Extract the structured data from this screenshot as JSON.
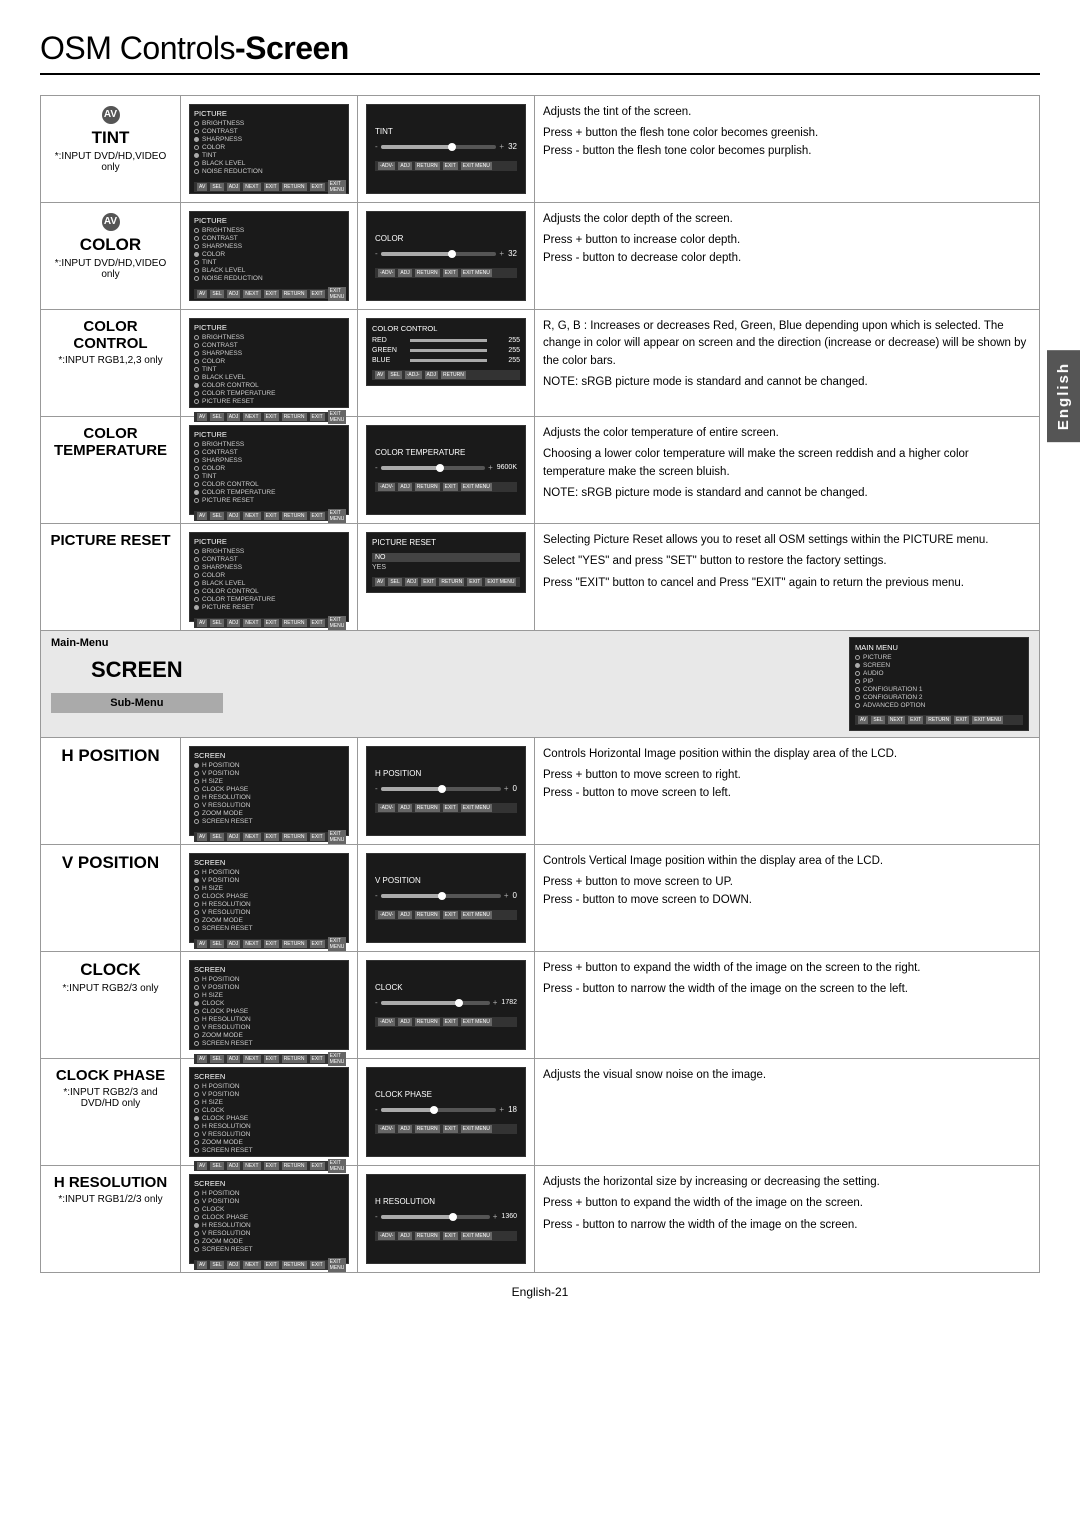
{
  "title": {
    "prefix": "OSM Controls",
    "suffix": "-Screen"
  },
  "english_tab": "English",
  "sections": {
    "tint": {
      "label": "TINT",
      "av_badge": "AV",
      "sub_label": "*:INPUT DVD/HD,VIDEO only",
      "slider_label": "TINT",
      "slider_value": "+ 32",
      "description": [
        "Adjusts the tint of the screen.",
        "Press + button the flesh tone color becomes greenish.",
        "Press - button the flesh tone color becomes purplish."
      ]
    },
    "color": {
      "label": "COLOR",
      "av_badge": "AV",
      "sub_label": "*:INPUT DVD/HD,VIDEO only",
      "slider_label": "COLOR",
      "slider_value": "+ 32",
      "description": [
        "Adjusts the color depth of the screen.",
        "Press + button to increase color depth.",
        "Press - button to decrease color depth."
      ]
    },
    "color_control": {
      "label": "COLOR CONTROL",
      "sub_label": "*:INPUT RGB1,2,3 only",
      "slider_label": "COLOR CONTROL",
      "rgb": {
        "red": {
          "label": "RED",
          "value": "255",
          "fill": 100
        },
        "green": {
          "label": "GREEN",
          "value": "255",
          "fill": 100
        },
        "blue": {
          "label": "BLUE",
          "value": "255",
          "fill": 100
        }
      },
      "description": [
        "R, G, B : Increases or decreases Red, Green, Blue depending upon which is selected. The change in color will appear on screen and the direction (increase or decrease) will be shown by the color bars.",
        "NOTE: sRGB picture mode is standard and cannot be changed."
      ]
    },
    "color_temperature": {
      "label": "COLOR TEMPERATURE",
      "slider_label": "COLOR TEMPERATURE",
      "slider_value": "9600K",
      "description": [
        "Adjusts the color temperature of entire screen.",
        "Choosing a lower color temperature will make the screen reddish and a higher color temperature make the screen bluish.",
        "NOTE: sRGB picture mode is standard and cannot be changed."
      ]
    },
    "picture_reset": {
      "label": "PICTURE RESET",
      "description": [
        "Selecting Picture Reset allows you to reset all OSM settings within the PICTURE menu.",
        "Select \"YES\" and press \"SET\" button to restore the factory settings.",
        "Press \"EXIT\" button to cancel and Press \"EXIT\" again to return the previous menu."
      ]
    }
  },
  "screen_section": {
    "main_menu_label": "Main-Menu",
    "main_menu_title": "SCREEN",
    "sub_menu_label": "Sub-Menu"
  },
  "screen_items": {
    "h_position": {
      "label": "H POSITION",
      "slider_label": "H POSITION",
      "slider_value": "+ 0",
      "description": [
        "Controls Horizontal Image position within the display area of the LCD.",
        "Press + button to move screen to right.",
        "Press - button to move screen to left."
      ]
    },
    "v_position": {
      "label": "V POSITION",
      "slider_label": "V POSITION",
      "slider_value": "+ 0",
      "description": [
        "Controls Vertical Image position within the display area of the LCD.",
        "Press + button to move screen to UP.",
        "Press - button to move screen to DOWN."
      ]
    },
    "clock": {
      "label": "CLOCK",
      "sub_label": "*:INPUT RGB2/3 only",
      "slider_label": "CLOCK",
      "slider_value": "+ 1782",
      "description": [
        "Press + button to expand the width of the image on the screen to the right.",
        "Press - button to narrow the width of the image on the screen to the left."
      ]
    },
    "clock_phase": {
      "label": "CLOCK PHASE",
      "sub_label": "*:INPUT RGB2/3 and DVD/HD only",
      "slider_label": "CLOCK PHASE",
      "slider_value": "+ 18",
      "description": [
        "Adjusts the visual snow noise on the image."
      ]
    },
    "h_resolution": {
      "label": "H RESOLUTION",
      "sub_label": "*:INPUT RGB1/2/3 only",
      "slider_label": "H RESOLUTION",
      "slider_value": "+ 1360",
      "description": [
        "Adjusts the horizontal size by increasing or decreasing the setting.",
        "Press + button to expand the width of the image on the screen.",
        "Press - button to narrow the width of the image on the screen."
      ]
    }
  },
  "footer": {
    "page": "English-21"
  },
  "picture_menu_items": [
    "BRIGHTNESS",
    "CONTRAST",
    "SHARPNESS",
    "COLOR",
    "TINT",
    "BLACK LEVEL",
    "NOISE REDUCTION"
  ],
  "picture_menu_items2": [
    "BRIGHTNESS",
    "CONTRAST",
    "SHARPNESS",
    "COLOR",
    "TINT",
    "BLACK LEVEL",
    "COLOR CONTROL",
    "COLOR TEMPERATURE",
    "PICTURE RESET"
  ],
  "screen_menu_items": [
    "H POSITION",
    "V POSITION",
    "H SIZE",
    "CLOCK PHASE",
    "H RESOLUTION",
    "V RESOLUTION",
    "ZOOM MODE",
    "SCREEN RESET"
  ]
}
